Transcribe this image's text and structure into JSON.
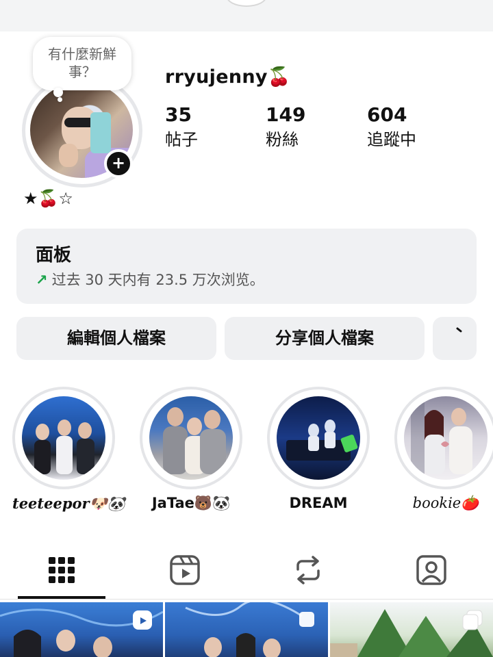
{
  "profile": {
    "username": "rryujenny🍒",
    "note": "有什麼新鮮事？",
    "bio": "★🍒☆",
    "stats": [
      {
        "value": "35",
        "label": "帖子"
      },
      {
        "value": "149",
        "label": "粉絲"
      },
      {
        "value": "604",
        "label": "追蹤中"
      }
    ]
  },
  "dashboard": {
    "title": "面板",
    "arrow": "↗",
    "summary": "过去 30 天内有 23.5 万次浏览。"
  },
  "actions": {
    "edit_label": "編輯個人檔案",
    "share_label": "分享個人檔案"
  },
  "highlights": [
    {
      "name": "teeteepor🐶🐼"
    },
    {
      "name": "JaTae🐻🐼"
    },
    {
      "name": "DREAM"
    },
    {
      "name": "bookie🍅"
    }
  ],
  "tabs": [
    {
      "icon": "grid-icon",
      "active": true
    },
    {
      "icon": "reels-icon",
      "active": false
    },
    {
      "icon": "repost-icon",
      "active": false
    },
    {
      "icon": "tagged-icon",
      "active": false
    }
  ],
  "colors": {
    "accent_green": "#1aa34a",
    "panel_bg": "#f0f1f3",
    "ring_gray": "#e4e5e8"
  }
}
